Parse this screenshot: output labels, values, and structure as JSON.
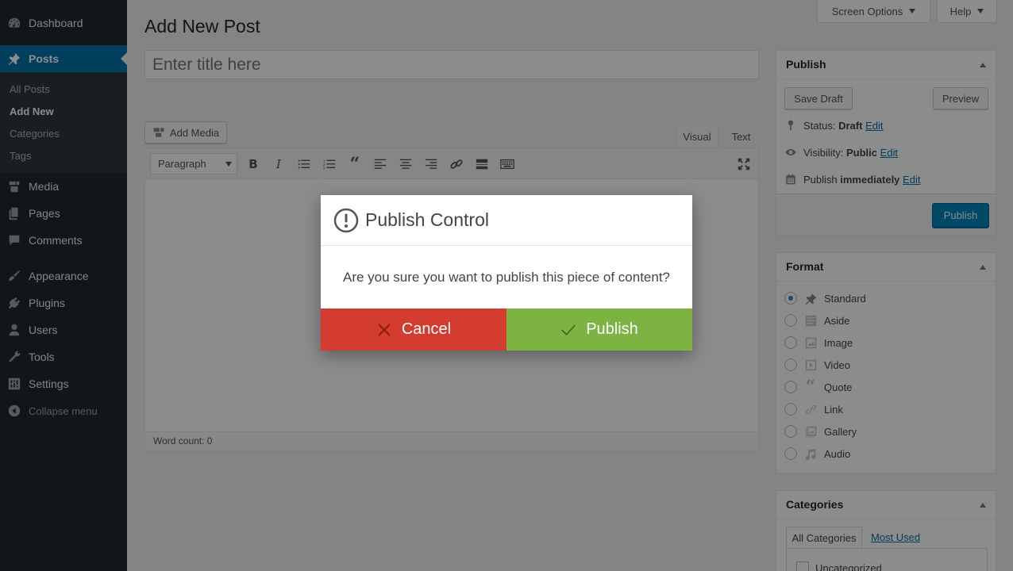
{
  "sidebar": {
    "dashboard": "Dashboard",
    "posts": "Posts",
    "submenu": [
      "All Posts",
      "Add New",
      "Categories",
      "Tags"
    ],
    "media": "Media",
    "pages": "Pages",
    "comments": "Comments",
    "appearance": "Appearance",
    "plugins": "Plugins",
    "users": "Users",
    "tools": "Tools",
    "settings": "Settings",
    "collapse": "Collapse menu"
  },
  "header": {
    "title": "Add New Post",
    "screen_options": "Screen Options",
    "help": "Help"
  },
  "editor": {
    "title_placeholder": "Enter title here",
    "add_media": "Add Media",
    "tab_visual": "Visual",
    "tab_text": "Text",
    "format_value": "Paragraph",
    "word_count": "Word count: 0"
  },
  "publish_box": {
    "title": "Publish",
    "save_draft": "Save Draft",
    "preview": "Preview",
    "status_label": "Status:",
    "status_value": "Draft",
    "visibility_label": "Visibility:",
    "visibility_value": "Public",
    "schedule_label": "Publish",
    "schedule_value": "immediately",
    "edit": "Edit",
    "publish_button": "Publish"
  },
  "format_box": {
    "title": "Format",
    "options": [
      "Standard",
      "Aside",
      "Image",
      "Video",
      "Quote",
      "Link",
      "Gallery",
      "Audio"
    ],
    "selected": "Standard"
  },
  "categories_box": {
    "title": "Categories",
    "tab_all": "All Categories",
    "tab_most_used": "Most Used",
    "items": [
      "Uncategorized"
    ]
  },
  "modal": {
    "title": "Publish Control",
    "message": "Are you sure you want to publish this piece of content?",
    "cancel": "Cancel",
    "publish": "Publish"
  },
  "colors": {
    "sidebar_bg": "#23282d",
    "accent": "#0073aa",
    "cancel": "#d33c2e",
    "publish": "#7cb342"
  }
}
